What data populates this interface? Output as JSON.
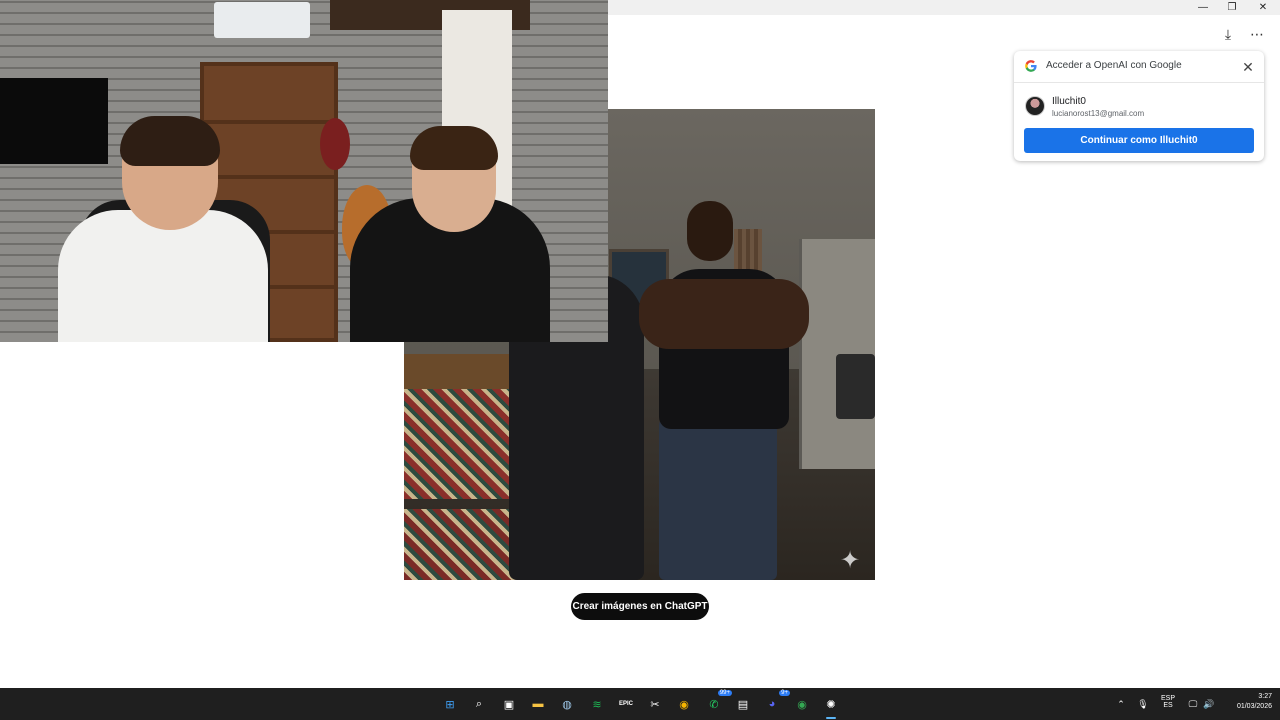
{
  "window": {
    "minimize_icon": "—",
    "restore_icon": "❐",
    "close_icon": "✕",
    "download_icon": "⤓",
    "more_icon": "⋯"
  },
  "main": {
    "sparkle_icon": "✦",
    "cta_label": "Crear imágenes en ChatGPT"
  },
  "google_popup": {
    "title": "Acceder a OpenAI con Google",
    "close_icon": "✕",
    "account_name": "Illuchit0",
    "account_email": "lucianorost13@gmail.com",
    "continue_label": "Continuar como Illuchit0"
  },
  "taskbar": {
    "apps": [
      {
        "name": "windows-start",
        "glyph": "⊞",
        "color": "#3fa0f5"
      },
      {
        "name": "search",
        "glyph": "⌕",
        "color": "#ffffff"
      },
      {
        "name": "store",
        "glyph": "▣",
        "color": "#ffffff"
      },
      {
        "name": "file-explorer",
        "glyph": "▬",
        "color": "#f6c343"
      },
      {
        "name": "steam",
        "glyph": "◍",
        "color": "#9ec7e8"
      },
      {
        "name": "spotify",
        "glyph": "≋",
        "color": "#1db954"
      },
      {
        "name": "epic-games",
        "glyph": "EPIC",
        "color": "#ffffff"
      },
      {
        "name": "capcut",
        "glyph": "✂",
        "color": "#ffffff"
      },
      {
        "name": "chrome",
        "glyph": "◉",
        "color": "#f4b400"
      },
      {
        "name": "whatsapp",
        "glyph": "✆",
        "color": "#25d366",
        "badge": "99+"
      },
      {
        "name": "app-window",
        "glyph": "▤",
        "color": "#ffffff"
      },
      {
        "name": "discord",
        "glyph": "◕",
        "color": "#5865f2",
        "badge": "9+"
      },
      {
        "name": "chrome-profile",
        "glyph": "◉",
        "color": "#34a853"
      },
      {
        "name": "chatgpt",
        "glyph": "✺",
        "color": "#ffffff"
      }
    ],
    "tray": {
      "chevron_icon": "⌃",
      "mic_icon": "🎙",
      "lang_top": "ESP",
      "lang_bottom": "ES",
      "network_icon": "🖵",
      "volume_icon": "🔊",
      "time": "3:27",
      "date": "01/03/2026"
    }
  }
}
